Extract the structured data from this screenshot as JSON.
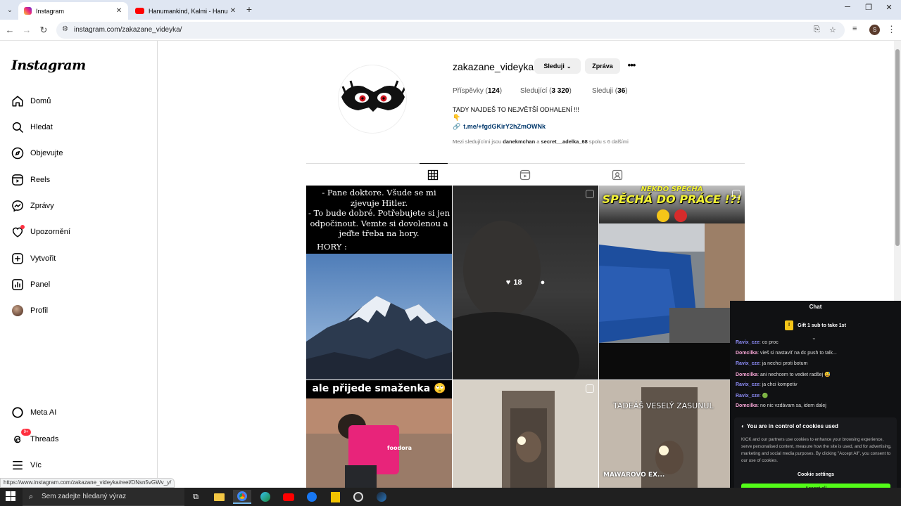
{
  "browser": {
    "tabs": [
      {
        "title": "Instagram",
        "active": true
      },
      {
        "title": "Hanumankind, Kalmi - Hanuma",
        "active": false
      }
    ],
    "url": "instagram.com/zakazane_videyka/",
    "profile_initial": "S",
    "status_url": "https://www.instagram.com/zakazane_videyka/reel/DNsn5vGWv_y/"
  },
  "sidebar": {
    "logo": "Instagram",
    "items": [
      {
        "label": "Domů",
        "icon": "home-icon"
      },
      {
        "label": "Hledat",
        "icon": "search-icon"
      },
      {
        "label": "Objevujte",
        "icon": "compass-icon"
      },
      {
        "label": "Reels",
        "icon": "reels-icon"
      },
      {
        "label": "Zprávy",
        "icon": "messenger-icon"
      },
      {
        "label": "Upozornění",
        "icon": "heart-icon"
      },
      {
        "label": "Vytvořit",
        "icon": "plus-square-icon"
      },
      {
        "label": "Panel",
        "icon": "chart-icon"
      },
      {
        "label": "Profil",
        "icon": "profile-avatar"
      }
    ],
    "bottom_items": [
      {
        "label": "Meta AI",
        "icon": "meta-ai-icon"
      },
      {
        "label": "Threads",
        "icon": "threads-icon",
        "badge": "9+"
      },
      {
        "label": "Víc",
        "icon": "menu-icon"
      }
    ]
  },
  "profile": {
    "username": "zakazane_videyka",
    "follow_label": "Sleduji",
    "message_label": "Zpráva",
    "stats": {
      "posts_label": "Příspěvky",
      "posts": "124",
      "followers_label": "Sledující",
      "followers": "3 320",
      "following_label": "Sleduji",
      "following": "36"
    },
    "bio": "TADY NAJDEŠ TO NEJVĚTŠÍ ODHALENÍ !!!",
    "bio_emoji": "👇",
    "link": "t.me/+fgdGKirY2hZmOWNk",
    "mutuals_prefix": "Mezi sledujícími jsou",
    "mutual_1": "danekmchan",
    "mutuals_and": "a",
    "mutual_2": "secret__adelka_68",
    "mutuals_suffix": "spolu s 6 dalšími"
  },
  "posts": {
    "p1_text": "- Pane doktore. Všude se mi zjevuje Hitler.\n- To bude dobré. Potřebujete si jen odpočinout. Vemte si dovolenou a jeďte třeba na hory.",
    "p1_hory": "HORY :",
    "p2_likes": "18",
    "p3_text_line1": "NĚKDO SPĚCHÁ",
    "p3_text_line2": "SPĚCHÁ DO PRÁCE !?!",
    "p4_text": "ale přijede smaženka 🙄",
    "p4_bag": "foodora",
    "p6_text": "TADEÁŠ VESELÝ ZASUNUL",
    "p6_bottom": "MAWAROVO EX..."
  },
  "chat": {
    "title": "Chat",
    "gift_text": "Gift 1 sub to take 1st",
    "messages": [
      {
        "user": "Ravix_cze",
        "text": ": co proc",
        "style": "u1"
      },
      {
        "user": "Domcilka",
        "text": ": vieš si nastaviť na dc push to talk...",
        "style": "u2"
      },
      {
        "user": "Ravix_cze",
        "text": ": ja nechci proti botum",
        "style": "u1"
      },
      {
        "user": "Domcilka",
        "text": ": ani nechcem to vediet radšej 😅",
        "style": "u2"
      },
      {
        "user": "Ravix_cze",
        "text": ": ja chci kompetiv",
        "style": "u1"
      },
      {
        "user": "Ravix_cze",
        "text": ": 🟢",
        "style": "u1"
      },
      {
        "user": "Domcilka",
        "text": ": no nic vzdávam sa, idem dalej",
        "style": "u2"
      }
    ]
  },
  "cookie": {
    "title": "You are in control of cookies used",
    "text": "KICK and our partners use cookies to enhance your browsing experience, serve personalised content, measure how the site is used, and for advertising, marketing and social media purposes. By clicking \"Accept All\", you consent to our use of cookies.",
    "settings_label": "Cookie settings",
    "accept_label": "Accept all"
  },
  "taskbar": {
    "search_placeholder": "Sem zadejte hledaný výraz"
  },
  "colors": {
    "accent_link": "#00376b",
    "kick_green": "#53fc18",
    "notification_red": "#ff3040"
  }
}
